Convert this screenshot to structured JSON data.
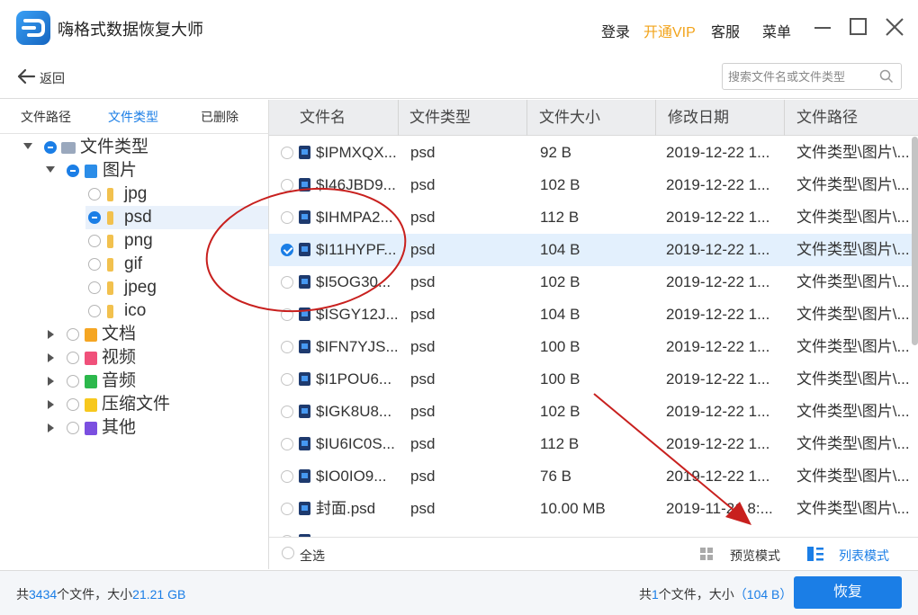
{
  "app": {
    "title": "嗨格式数据恢复大师",
    "login": "登录",
    "vip": "开通VIP",
    "service": "客服",
    "menu": "菜单"
  },
  "nav": {
    "back": "返回",
    "search_placeholder": "搜索文件名或文件类型"
  },
  "sidebar": {
    "tabs": [
      "文件路径",
      "文件类型",
      "已删除"
    ],
    "tree": {
      "root": "文件类型",
      "images": "图片",
      "image_types": [
        "jpg",
        "psd",
        "png",
        "gif",
        "jpeg",
        "ico"
      ],
      "docs": "文档",
      "video": "视频",
      "audio": "音频",
      "archive": "压缩文件",
      "other": "其他"
    }
  },
  "table": {
    "headers": [
      "文件名",
      "文件类型",
      "文件大小",
      "修改日期",
      "文件路径"
    ],
    "rows": [
      {
        "name": "$IPMXQX...",
        "type": "psd",
        "size": "92 B",
        "date": "2019-12-22 1...",
        "path": "文件类型\\图片\\..."
      },
      {
        "name": "$I46JBD9...",
        "type": "psd",
        "size": "102 B",
        "date": "2019-12-22 1...",
        "path": "文件类型\\图片\\..."
      },
      {
        "name": "$IHMPA2...",
        "type": "psd",
        "size": "112 B",
        "date": "2019-12-22 1...",
        "path": "文件类型\\图片\\..."
      },
      {
        "name": "$I11HYPF...",
        "type": "psd",
        "size": "104 B",
        "date": "2019-12-22 1...",
        "path": "文件类型\\图片\\..."
      },
      {
        "name": "$I5OG30...",
        "type": "psd",
        "size": "102 B",
        "date": "2019-12-22 1...",
        "path": "文件类型\\图片\\..."
      },
      {
        "name": "$ISGY12J...",
        "type": "psd",
        "size": "104 B",
        "date": "2019-12-22 1...",
        "path": "文件类型\\图片\\..."
      },
      {
        "name": "$IFN7YJS...",
        "type": "psd",
        "size": "100 B",
        "date": "2019-12-22 1...",
        "path": "文件类型\\图片\\..."
      },
      {
        "name": "$I1POU6...",
        "type": "psd",
        "size": "100 B",
        "date": "2019-12-22 1...",
        "path": "文件类型\\图片\\..."
      },
      {
        "name": "$IGK8U8...",
        "type": "psd",
        "size": "102 B",
        "date": "2019-12-22 1...",
        "path": "文件类型\\图片\\..."
      },
      {
        "name": "$IU6IC0S...",
        "type": "psd",
        "size": "112 B",
        "date": "2019-12-22 1...",
        "path": "文件类型\\图片\\..."
      },
      {
        "name": "$IO0IO9...",
        "type": "psd",
        "size": "76 B",
        "date": "2019-12-22 1...",
        "path": "文件类型\\图片\\..."
      },
      {
        "name": "封面.psd",
        "type": "psd",
        "size": "10.00 MB",
        "date": "2019-11-21 8:...",
        "path": "文件类型\\图片\\..."
      }
    ]
  },
  "footer": {
    "select_all": "全选",
    "preview_mode": "预览模式",
    "list_mode": "列表模式"
  },
  "status": {
    "total_prefix": "共",
    "total_count": "3434",
    "total_mid": "个文件，大小",
    "total_size": "21.21 GB",
    "sel_prefix": "共",
    "sel_count": "1",
    "sel_mid": "个文件，大小",
    "sel_size": "（104 B）",
    "recover": "恢复"
  }
}
